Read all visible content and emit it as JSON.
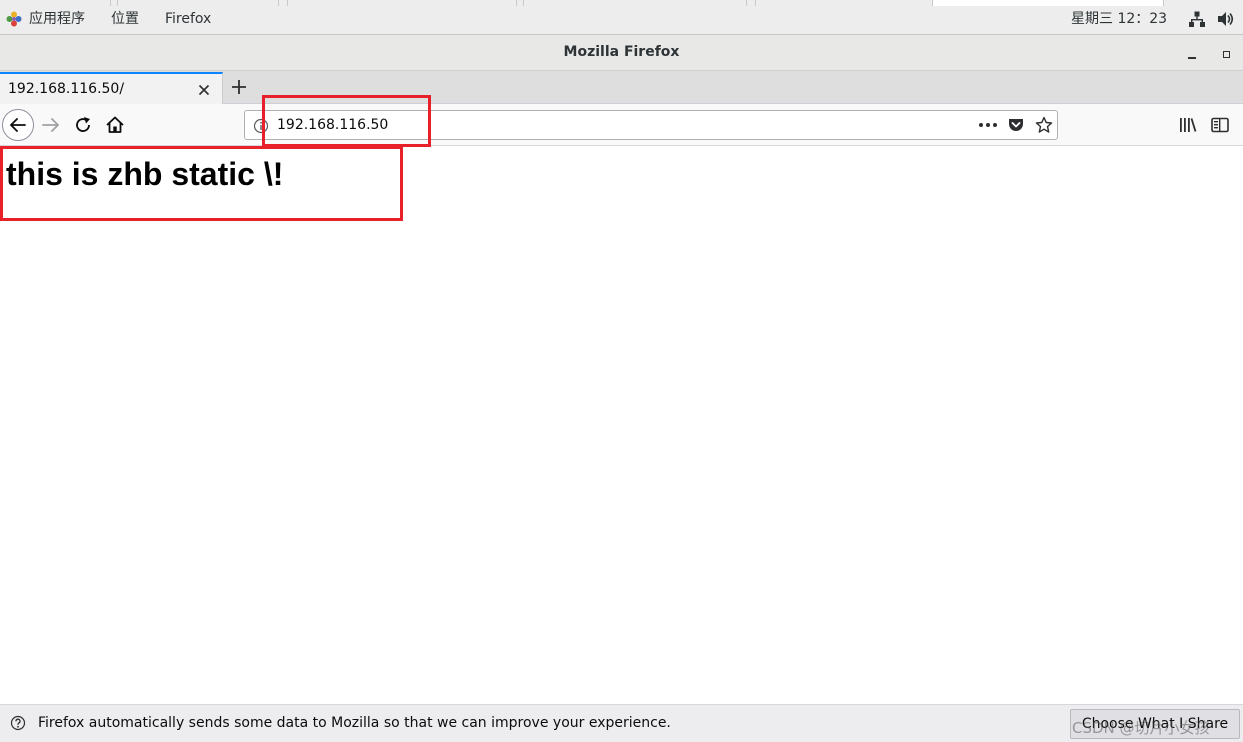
{
  "topbar": {
    "applications_menu": "应用程序",
    "places_menu": "位置",
    "app_menu": "Firefox",
    "clock": "星期三 12：23"
  },
  "window": {
    "title": "Mozilla Firefox"
  },
  "tabs": [
    {
      "title": "192.168.116.50/"
    }
  ],
  "navbar": {
    "url": "192.168.116.50"
  },
  "page": {
    "heading": "this is zhb static \\!"
  },
  "notification": {
    "text": "Firefox automatically sends some data to Mozilla so that we can improve your experience.",
    "button_label": "Choose What I Share"
  },
  "watermark": "CSDN @切片小女孩",
  "colors": {
    "annotation_red": "#e8202a",
    "active_tab_accent": "#0a84ff"
  }
}
